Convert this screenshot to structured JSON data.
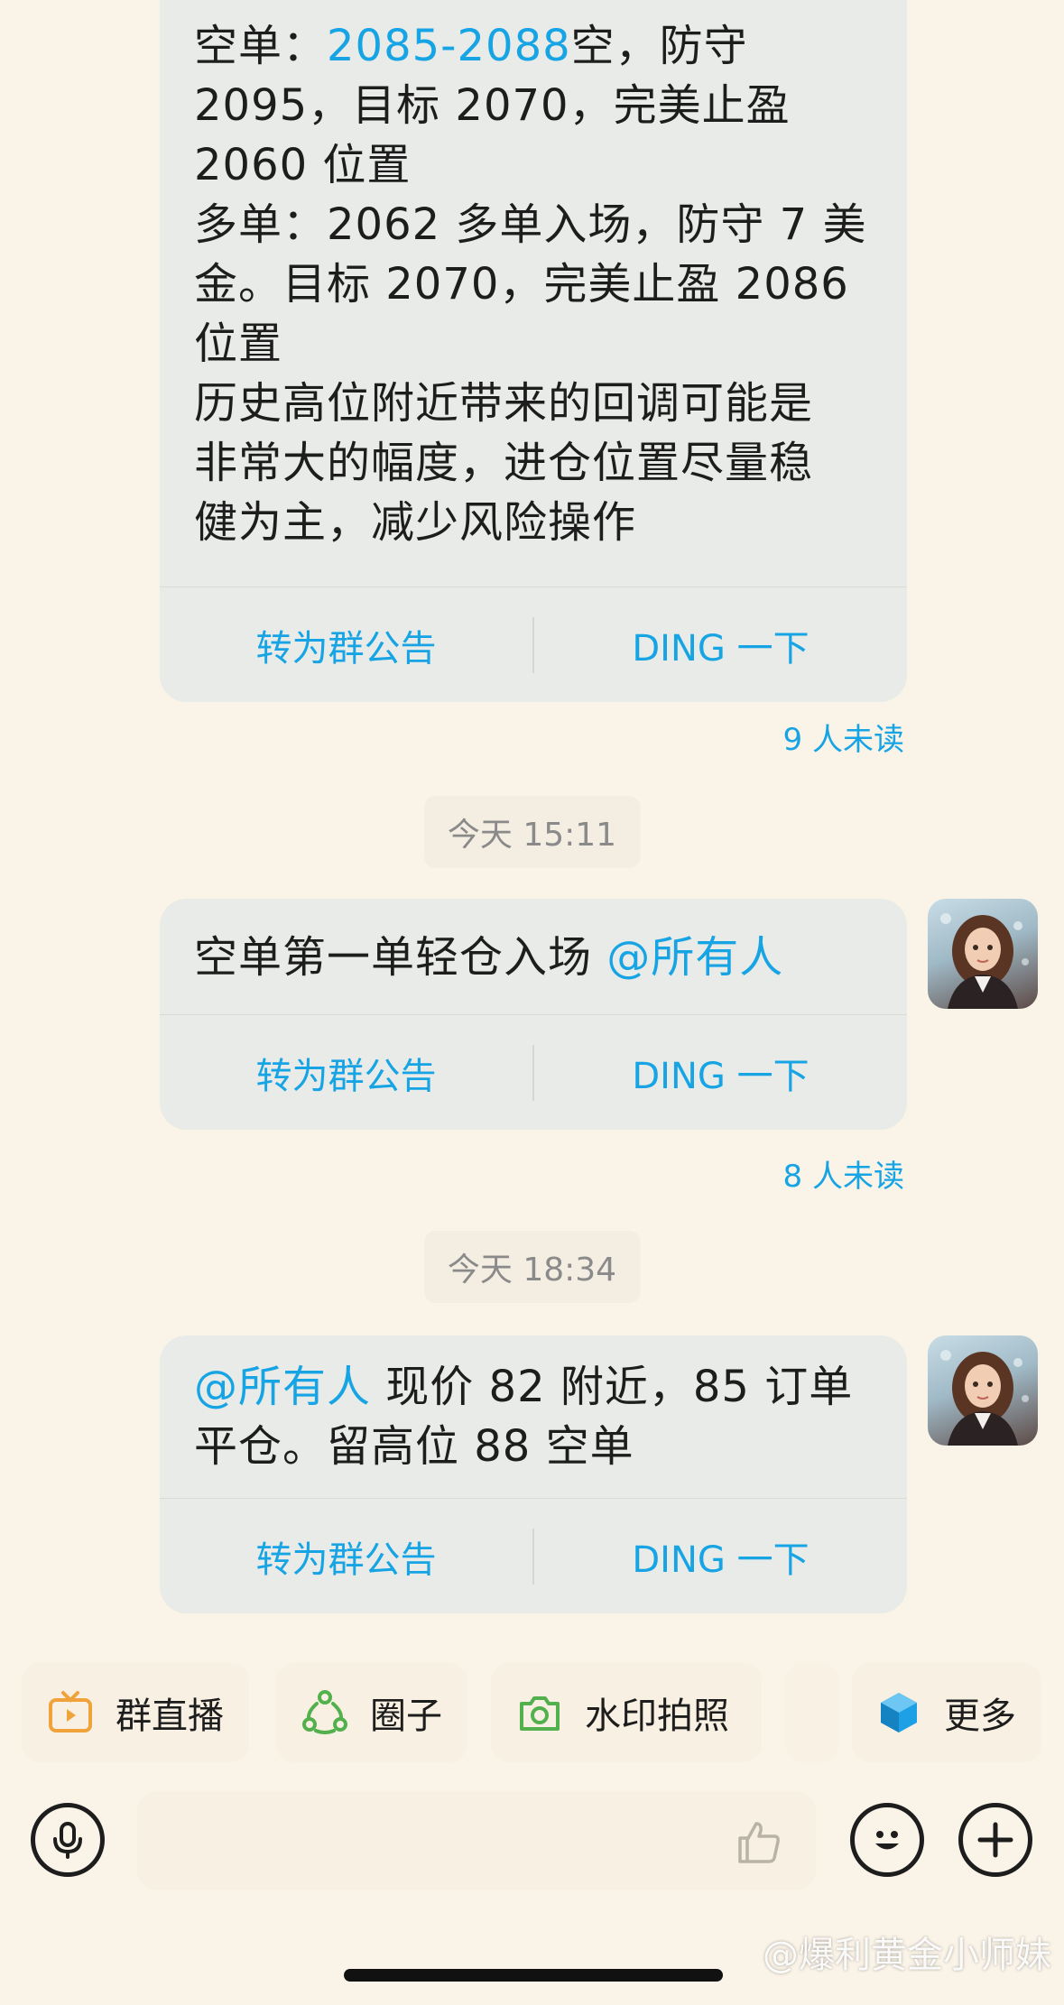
{
  "messages": [
    {
      "lines": [
        {
          "parts": [
            {
              "t": "空单："
            },
            {
              "t": "2085-2088",
              "hl": true
            },
            {
              "t": "空，防守"
            }
          ]
        },
        {
          "parts": [
            {
              "t": "2095，目标 2070，完美止盈"
            }
          ]
        },
        {
          "parts": [
            {
              "t": "2060 位置"
            }
          ]
        },
        {
          "parts": [
            {
              "t": "多单：2062 多单入场，防守 7 美"
            }
          ]
        },
        {
          "parts": [
            {
              "t": "金。目标 2070，完美止盈 2086"
            }
          ]
        },
        {
          "parts": [
            {
              "t": "位置"
            }
          ]
        },
        {
          "parts": [
            {
              "t": "历史高位附近带来的回调可能是"
            }
          ]
        },
        {
          "parts": [
            {
              "t": "非常大的幅度，进仓位置尽量稳"
            }
          ]
        },
        {
          "parts": [
            {
              "t": "健为主，减少风险操作"
            }
          ]
        }
      ],
      "announce_label": "转为群公告",
      "ding_label": "DING 一下",
      "unread": "9 人未读"
    },
    {
      "time": "今天 15:11",
      "lines": [
        {
          "parts": [
            {
              "t": "空单第一单轻仓入场 "
            },
            {
              "t": "@所有人",
              "hl": true
            }
          ]
        }
      ],
      "announce_label": "转为群公告",
      "ding_label": "DING 一下",
      "unread": "8 人未读"
    },
    {
      "time": "今天 18:34",
      "lines": [
        {
          "parts": [
            {
              "t": "@所有人",
              "hl": true
            },
            {
              "t": " 现价 82 附近，85 订单"
            }
          ]
        },
        {
          "parts": [
            {
              "t": "平仓。留高位 88 空单"
            }
          ]
        }
      ],
      "announce_label": "转为群公告",
      "ding_label": "DING 一下"
    }
  ],
  "toolbar": {
    "items": [
      {
        "label": "群直播",
        "icon": "tv-icon",
        "color": "#f1a33b"
      },
      {
        "label": "圈子",
        "icon": "circle-group-icon",
        "color": "#52b04d"
      },
      {
        "label": "水印拍照",
        "icon": "camera-icon",
        "color": "#52b04d"
      },
      {
        "label": "更多",
        "icon": "cube-icon",
        "color": "#1ea0e6"
      }
    ]
  },
  "input": {
    "placeholder": ""
  },
  "watermark": "@爆利黄金小师妹"
}
